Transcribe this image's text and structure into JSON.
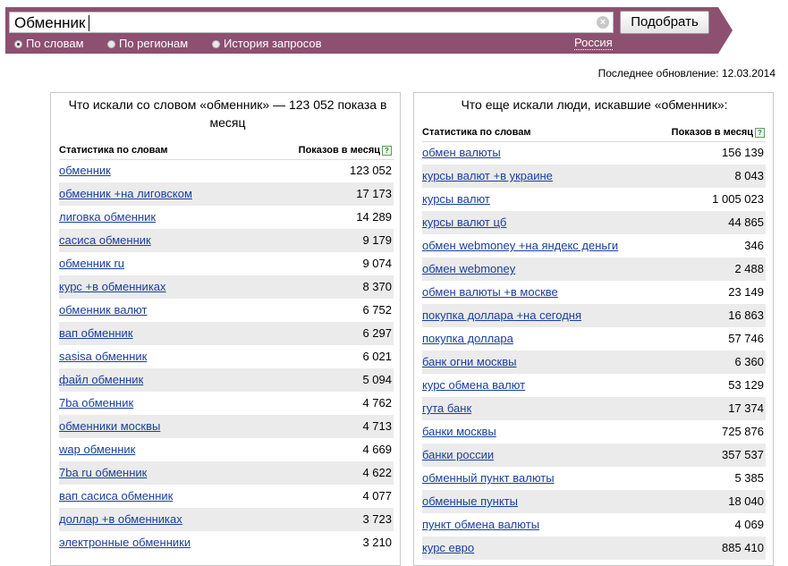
{
  "search": {
    "query": "Обменник",
    "clear_glyph": "×",
    "submit_label": "Подобрать"
  },
  "modes": [
    {
      "label": "По словам",
      "selected": true
    },
    {
      "label": "По регионам",
      "selected": false
    },
    {
      "label": "История запросов",
      "selected": false
    }
  ],
  "region": "Россия",
  "last_update": "Последнее обновление: 12.03.2014",
  "left_panel": {
    "title": "Что искали со словом «обменник» — 123 052 показа в месяц",
    "col_query": "Статистика по словам",
    "col_count": "Показов в месяц",
    "help_glyph": "?",
    "rows": [
      {
        "q": "обменник",
        "n": "123 052"
      },
      {
        "q": "обменник +на лиговском",
        "n": "17 173"
      },
      {
        "q": "лиговка обменник",
        "n": "14 289"
      },
      {
        "q": "сасиса обменник",
        "n": "9 179"
      },
      {
        "q": "обменник ru",
        "n": "9 074"
      },
      {
        "q": "курс +в обменниках",
        "n": "8 370"
      },
      {
        "q": "обменник валют",
        "n": "6 752"
      },
      {
        "q": "вап обменник",
        "n": "6 297"
      },
      {
        "q": "sasisa обменник",
        "n": "6 021"
      },
      {
        "q": "файл обменник",
        "n": "5 094"
      },
      {
        "q": "7ba обменник",
        "n": "4 762"
      },
      {
        "q": "обменники москвы",
        "n": "4 713"
      },
      {
        "q": "wap обменник",
        "n": "4 669"
      },
      {
        "q": "7ba ru обменник",
        "n": "4 622"
      },
      {
        "q": "вап сасиса обменник",
        "n": "4 077"
      },
      {
        "q": "доллар +в обменниках",
        "n": "3 723"
      },
      {
        "q": "электронные обменники",
        "n": "3 210"
      }
    ]
  },
  "right_panel": {
    "title": "Что еще искали люди, искавшие «обменник»:",
    "col_query": "Статистика по словам",
    "col_count": "Показов в месяц",
    "help_glyph": "?",
    "rows": [
      {
        "q": "обмен валюты",
        "n": "156 139"
      },
      {
        "q": "курсы валют +в украине",
        "n": "8 043"
      },
      {
        "q": "курсы валют",
        "n": "1 005 023"
      },
      {
        "q": "курсы валют цб",
        "n": "44 865"
      },
      {
        "q": "обмен webmoney +на яндекс деньги",
        "n": "346"
      },
      {
        "q": "обмен webmoney",
        "n": "2 488"
      },
      {
        "q": "обмен валюты +в москве",
        "n": "23 149"
      },
      {
        "q": "покупка доллара +на сегодня",
        "n": "16 863"
      },
      {
        "q": "покупка доллара",
        "n": "57 746"
      },
      {
        "q": "банк огни москвы",
        "n": "6 360"
      },
      {
        "q": "курс обмена валют",
        "n": "53 129"
      },
      {
        "q": "гута банк",
        "n": "17 374"
      },
      {
        "q": "банки москвы",
        "n": "725 876"
      },
      {
        "q": "банки россии",
        "n": "357 537"
      },
      {
        "q": "обменный пункт валюты",
        "n": "5 385"
      },
      {
        "q": "обменные пункты",
        "n": "18 040"
      },
      {
        "q": "пункт обмена валюты",
        "n": "4 069"
      },
      {
        "q": "курс евро",
        "n": "885 410"
      }
    ]
  }
}
